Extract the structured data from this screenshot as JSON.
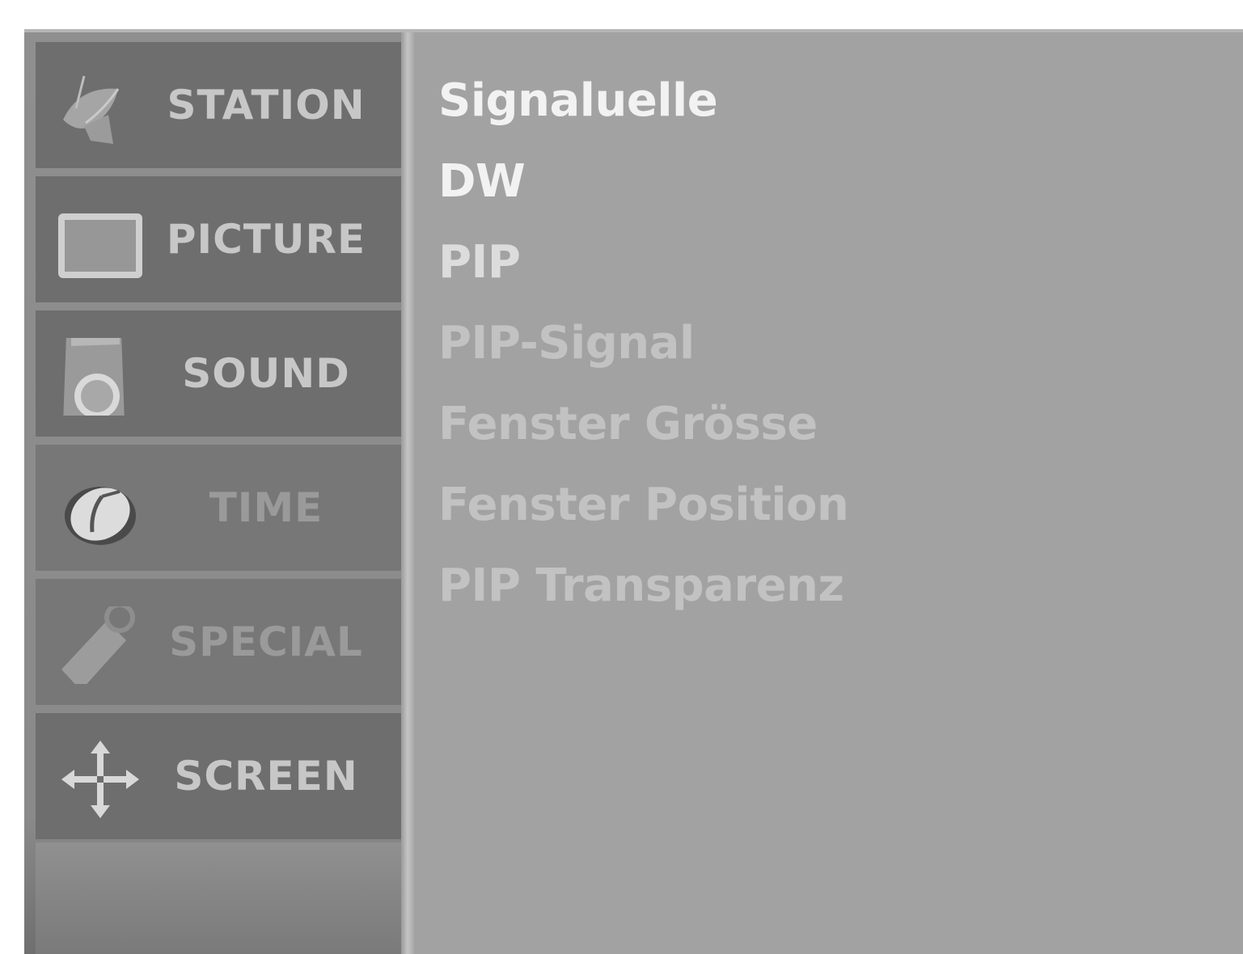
{
  "sidebar": {
    "tabs": [
      {
        "label": "STATION",
        "icon": "satellite-dish-icon"
      },
      {
        "label": "PICTURE",
        "icon": "picture-frame-icon"
      },
      {
        "label": "SOUND",
        "icon": "speaker-icon"
      },
      {
        "label": "TIME",
        "icon": "clock-icon"
      },
      {
        "label": "SPECIAL",
        "icon": "tag-icon"
      },
      {
        "label": "SCREEN",
        "icon": "move-arrows-icon"
      }
    ]
  },
  "menu": {
    "items": [
      {
        "label": "Signaluelle"
      },
      {
        "label": "DW"
      },
      {
        "label": "PIP"
      },
      {
        "label": "PIP-Signal"
      },
      {
        "label": "Fenster Grösse"
      },
      {
        "label": "Fenster Position"
      },
      {
        "label": "PIP Transparenz"
      }
    ]
  }
}
